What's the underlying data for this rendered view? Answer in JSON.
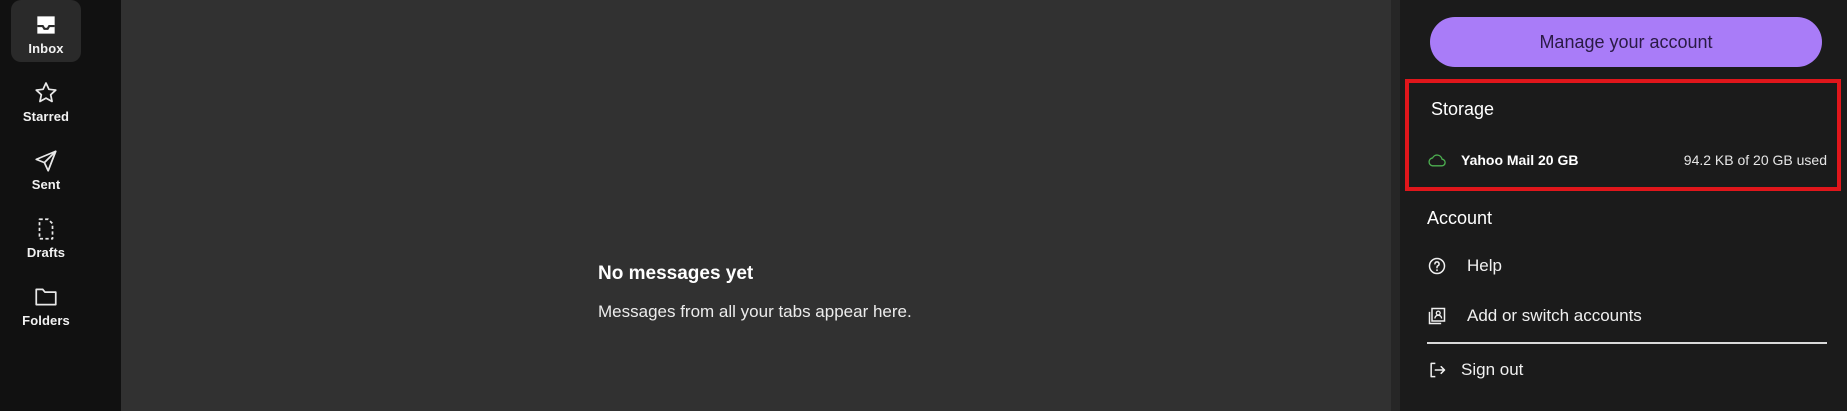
{
  "nav": {
    "items": [
      {
        "label": "Inbox",
        "icon": "inbox-icon",
        "active": true
      },
      {
        "label": "Starred",
        "icon": "star-icon",
        "active": false
      },
      {
        "label": "Sent",
        "icon": "send-icon",
        "active": false
      },
      {
        "label": "Drafts",
        "icon": "draft-icon",
        "active": false
      },
      {
        "label": "Folders",
        "icon": "folder-icon",
        "active": false
      }
    ]
  },
  "main": {
    "empty_title": "No messages yet",
    "empty_subtitle": "Messages from all your tabs appear here."
  },
  "panel": {
    "manage_label": "Manage your account",
    "storage": {
      "heading": "Storage",
      "plan": "Yahoo Mail 20 GB",
      "usage": "94.2 KB of 20 GB used",
      "icon": "cloud-icon"
    },
    "account": {
      "heading": "Account",
      "help_label": "Help",
      "switch_label": "Add or switch accounts",
      "signout_label": "Sign out"
    }
  },
  "colors": {
    "accent": "#a97cf8",
    "highlight_border": "#e0161b",
    "cloud_icon": "#4caf50"
  }
}
